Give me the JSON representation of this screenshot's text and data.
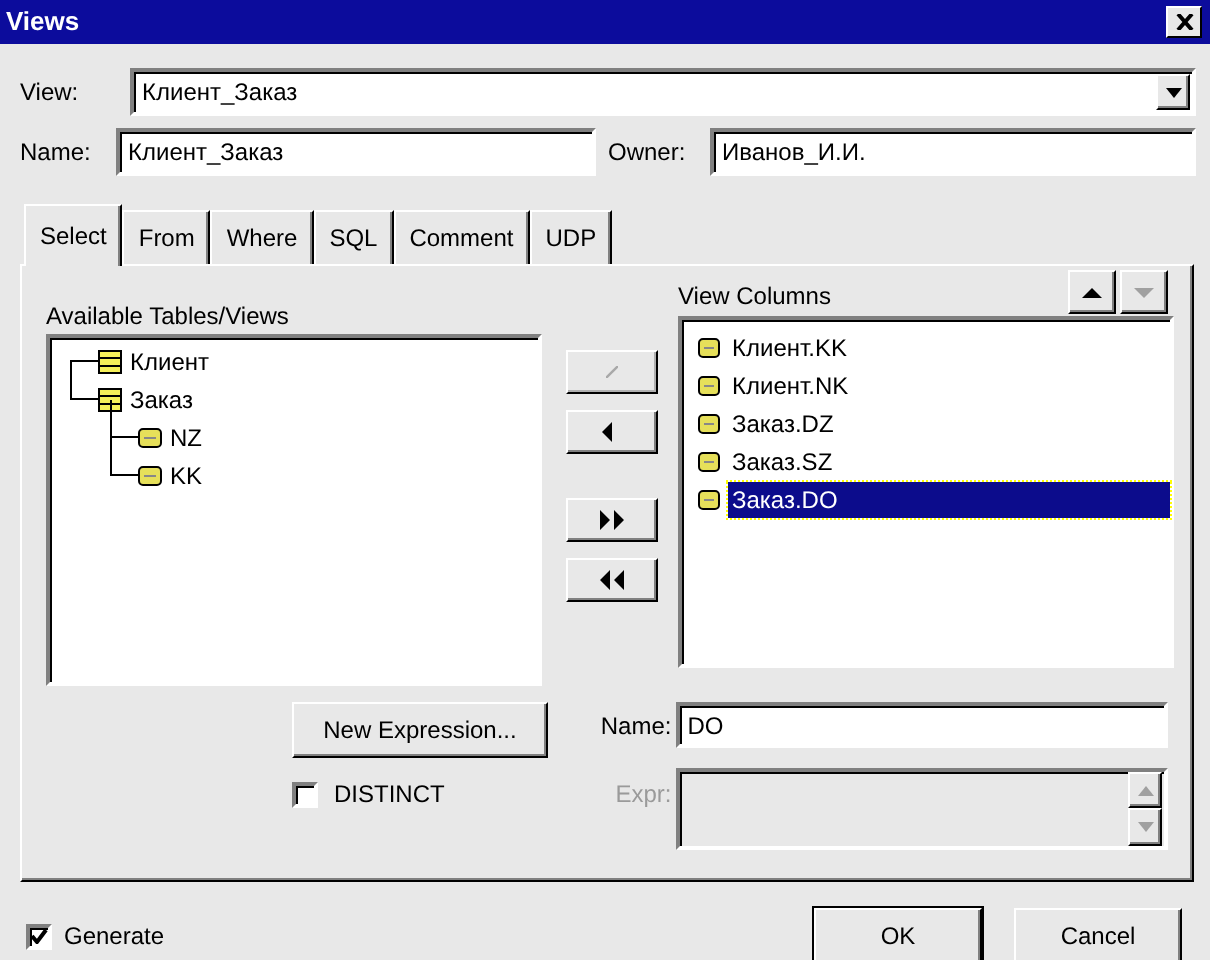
{
  "window": {
    "title": "Views"
  },
  "view": {
    "label": "View:",
    "value": "Клиент_Заказ"
  },
  "name": {
    "label": "Name:",
    "value": "Клиент_Заказ"
  },
  "owner": {
    "label": "Owner:",
    "value": "Иванов_И.И."
  },
  "tabs": [
    {
      "label": "Select",
      "selected": true
    },
    {
      "label": "From",
      "selected": false
    },
    {
      "label": "Where",
      "selected": false
    },
    {
      "label": "SQL",
      "selected": false
    },
    {
      "label": "Comment",
      "selected": false
    },
    {
      "label": "UDP",
      "selected": false
    }
  ],
  "available": {
    "label": "Available Tables/Views",
    "items": [
      {
        "label": "Клиент",
        "kind": "table"
      },
      {
        "label": "Заказ",
        "kind": "table",
        "children": [
          {
            "label": "NZ",
            "kind": "column"
          },
          {
            "label": "KK",
            "kind": "column"
          }
        ]
      }
    ]
  },
  "transfer_buttons": [
    {
      "kind": "add",
      "disabled": true
    },
    {
      "kind": "remove",
      "disabled": false
    },
    {
      "kind": "add-all",
      "disabled": false
    },
    {
      "kind": "remove-all",
      "disabled": false
    }
  ],
  "order_buttons": [
    {
      "kind": "up",
      "disabled": false
    },
    {
      "kind": "down",
      "disabled": true
    }
  ],
  "view_columns": {
    "label": "View Columns",
    "items": [
      {
        "label": "Клиент.KK",
        "selected": false
      },
      {
        "label": "Клиент.NK",
        "selected": false
      },
      {
        "label": "Заказ.DZ",
        "selected": false
      },
      {
        "label": "Заказ.SZ",
        "selected": false
      },
      {
        "label": "Заказ.DO",
        "selected": true
      }
    ]
  },
  "new_expression": "New Expression...",
  "distinct": {
    "label": "DISTINCT",
    "checked": false
  },
  "column_name": {
    "label": "Name:",
    "value": "DO"
  },
  "expr": {
    "label": "Expr:",
    "disabled": true
  },
  "generate": {
    "label": "Generate",
    "checked": true
  },
  "buttons": [
    {
      "label": "OK",
      "default": true
    },
    {
      "label": "Cancel",
      "default": false
    }
  ]
}
